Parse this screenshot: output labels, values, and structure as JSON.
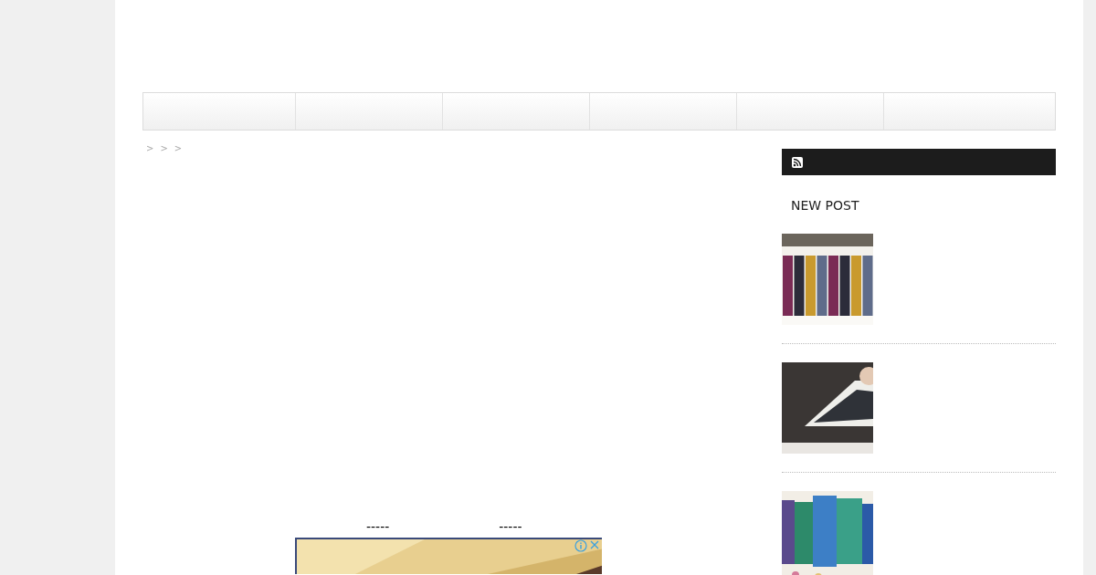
{
  "breadcrumb": {
    "separators": [
      ">",
      ">",
      ">"
    ]
  },
  "sidebar": {
    "heading": "NEW POST",
    "posts": [
      {
        "kind": "picture"
      },
      {
        "kind": "picture"
      },
      {
        "kind": "picture"
      }
    ]
  },
  "main": {
    "dividers": [
      "-----",
      "-----"
    ],
    "ad": {
      "kind": "picture"
    }
  }
}
